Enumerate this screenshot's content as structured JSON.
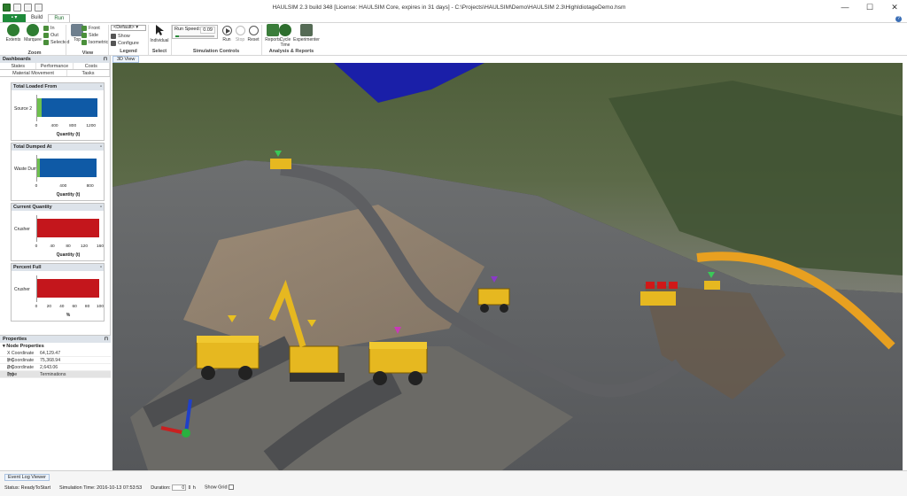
{
  "window": {
    "title": "HAULSIM 2.3 build 348 [License: HAULSIM Core, expires in 31 days] - C:\\Projects\\HAULSIM\\Demo\\HAULSIM 2.3\\HighIdiotageDemo.hsm",
    "controls": [
      "—",
      "☐",
      "✕"
    ]
  },
  "ribbon": {
    "tabs": [
      "Build",
      "Run"
    ],
    "active_tab": "Run",
    "zoom": {
      "label": "Zoom",
      "extents": "Extents",
      "marquee": "Marquee",
      "in": "In",
      "out": "Out",
      "selected": "Selected"
    },
    "view": {
      "label": "View",
      "top": "Top",
      "front": "Front",
      "side": "Side",
      "isometric": "Isometric"
    },
    "legend": {
      "label": "Legend",
      "combo_value": "<Default>",
      "show": "Show",
      "configure": "Configure"
    },
    "select": {
      "label": "Select",
      "individual": "Individual"
    },
    "simulation": {
      "label": "Simulation Controls",
      "run_speed_label": "Run Speed:",
      "run_speed_value": "0.09",
      "run_speed_fraction": 0.09,
      "run": "Run",
      "stop": "Stop",
      "reset": "Reset"
    },
    "analysis": {
      "label": "Analysis & Reports",
      "reports": "Reports",
      "cycle_time": "Cycle Time",
      "experimenter": "Experimenter"
    }
  },
  "dashboards": {
    "title": "Dashboards",
    "tabs_row1": [
      "States",
      "Performance",
      "Costs"
    ],
    "tabs_row2": [
      "Material Movement",
      "Tasks"
    ],
    "active_tab": "Material Movement",
    "cards": [
      {
        "title": "Total Loaded From",
        "category": "Source 2",
        "xmax": 1400,
        "value": 1320,
        "green_value": 90,
        "color": "#0f5aa6",
        "ticks": [
          "0",
          "400",
          "800",
          "1200"
        ],
        "tick_values": [
          0,
          400,
          800,
          1200
        ],
        "axis_title": "Quantity (t)"
      },
      {
        "title": "Total Dumped At",
        "category": "Waste Dump",
        "xmax": 950,
        "value": 890,
        "green_value": 40,
        "color": "#0f5aa6",
        "ticks": [
          "0",
          "400",
          "800"
        ],
        "tick_values": [
          0,
          400,
          800
        ],
        "axis_title": "Quantity (t)"
      },
      {
        "title": "Current Quantity",
        "category": "Crusher",
        "xmax": 160,
        "value": 155,
        "green_value": 0,
        "color": "#c4161c",
        "ticks": [
          "0",
          "40",
          "80",
          "120",
          "160"
        ],
        "tick_values": [
          0,
          40,
          80,
          120,
          160
        ],
        "axis_title": "Quantity (t)"
      },
      {
        "title": "Percent Full",
        "category": "Crusher",
        "xmax": 100,
        "value": 97,
        "green_value": 0,
        "color": "#c4161c",
        "ticks": [
          "0",
          "20",
          "40",
          "60",
          "80",
          "100"
        ],
        "tick_values": [
          0,
          20,
          40,
          60,
          80,
          100
        ],
        "axis_title": "%"
      }
    ]
  },
  "properties": {
    "title": "Properties",
    "category": "Node Properties",
    "rows": [
      {
        "key": "X Coordinate (m)",
        "value": "64,129.47"
      },
      {
        "key": "Y Coordinate (m)",
        "value": "75,368.94"
      },
      {
        "key": "Z Coordinate (m)",
        "value": "2,643.06"
      },
      {
        "key": "Type",
        "value": "Terminations"
      }
    ]
  },
  "view3d": {
    "tab": "3D View"
  },
  "statusbar": {
    "event_log": "Event Log Viewer",
    "status": "Status: ReadyToStart",
    "sim_time": "Simulation Time: 2016-10-13 07:53:53",
    "duration_label": "Duration:",
    "duration_value": "0",
    "duration_unit": "h",
    "show_grid": "Show Grid"
  }
}
